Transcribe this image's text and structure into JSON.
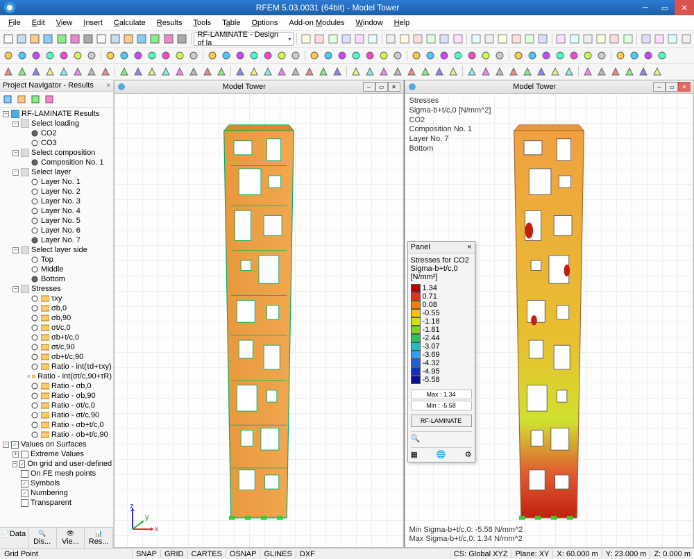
{
  "app": {
    "title": "RFEM 5.03.0031 (64bit) - Model Tower"
  },
  "menu": [
    "File",
    "Edit",
    "View",
    "Insert",
    "Calculate",
    "Results",
    "Tools",
    "Table",
    "Options",
    "Add-on Modules",
    "Window",
    "Help"
  ],
  "combo_module": "RF-LAMINATE - Design of la",
  "navigator": {
    "title": "Project Navigator - Results",
    "root": "RF-LAMINATE Results",
    "groups": {
      "select_loading": "Select loading",
      "co2": "CO2",
      "co3": "CO3",
      "select_composition": "Select composition",
      "comp1": "Composition No. 1",
      "select_layer": "Select layer",
      "layers": [
        "Layer No. 1",
        "Layer No. 2",
        "Layer No. 3",
        "Layer No. 4",
        "Layer No. 5",
        "Layer No. 6",
        "Layer No. 7"
      ],
      "select_layer_side": "Select layer side",
      "sides": [
        "Top",
        "Middle",
        "Bottom"
      ],
      "stresses": "Stresses",
      "stress_items": [
        "τxy",
        "σb,0",
        "σb,90",
        "σt/c,0",
        "σb+t/c,0",
        "σt/c,90",
        "σb+t/c,90",
        "Ratio - int(τd+τxy)",
        "Ratio - int(σt/c,90+τR)",
        "Ratio - σb,0",
        "Ratio - σb,90",
        "Ratio - σt/c,0",
        "Ratio - σt/c,90",
        "Ratio - σb+t/c,0",
        "Ratio - σb+t/c,90"
      ],
      "values_on_surfaces": "Values on Surfaces",
      "vos": [
        "Extreme Values",
        "On grid and user-defined p",
        "On FE mesh points",
        "Symbols",
        "Numbering",
        "Transparent"
      ]
    },
    "tabs": [
      "Data",
      "Dis...",
      "Vie...",
      "Res..."
    ]
  },
  "viewports": {
    "left": {
      "title": "Model Tower"
    },
    "right": {
      "title": "Model Tower",
      "overlay": [
        "Stresses",
        "Sigma-b+t/c,0 [N/mm^2]",
        "CO2",
        "Composition No. 1",
        "Layer No. 7",
        "Bottom"
      ],
      "footer": [
        "Min Sigma-b+t/c,0: -5.58 N/mm^2",
        "Max Sigma-b+t/c,0: 1.34 N/mm^2"
      ]
    }
  },
  "panel": {
    "title": "Panel",
    "subtitle1": "Stresses for CO2",
    "subtitle2": "Sigma-b+t/c,0 [N/mm²]",
    "scale": [
      {
        "c": "#b00000",
        "v": "1.34"
      },
      {
        "c": "#e03020",
        "v": "0.71"
      },
      {
        "c": "#f08000",
        "v": "0.08"
      },
      {
        "c": "#f8c000",
        "v": "-0.55"
      },
      {
        "c": "#d8e000",
        "v": "-1.18"
      },
      {
        "c": "#80d020",
        "v": "-1.81"
      },
      {
        "c": "#30c060",
        "v": "-2.44"
      },
      {
        "c": "#20c0c0",
        "v": "-3.07"
      },
      {
        "c": "#30a0f0",
        "v": "-3.69"
      },
      {
        "c": "#2060e0",
        "v": "-4.32"
      },
      {
        "c": "#1030c0",
        "v": "-4.95"
      },
      {
        "c": "#0010a0",
        "v": "-5.58"
      }
    ],
    "max": "Max :   1.34",
    "min": "Min :  -5.58",
    "button": "RF-LAMINATE"
  },
  "status": {
    "left": "Grid Point",
    "snap": "SNAP",
    "grid": "GRID",
    "cartes": "CARTES",
    "osnap": "OSNAP",
    "glines": "GLINES",
    "dxf": "DXF",
    "cs": "CS: Global XYZ",
    "plane": "Plane: XY",
    "x": "X: 60.000 m",
    "y": "Y: 23.000 m",
    "z": "Z: 0.000 m"
  }
}
